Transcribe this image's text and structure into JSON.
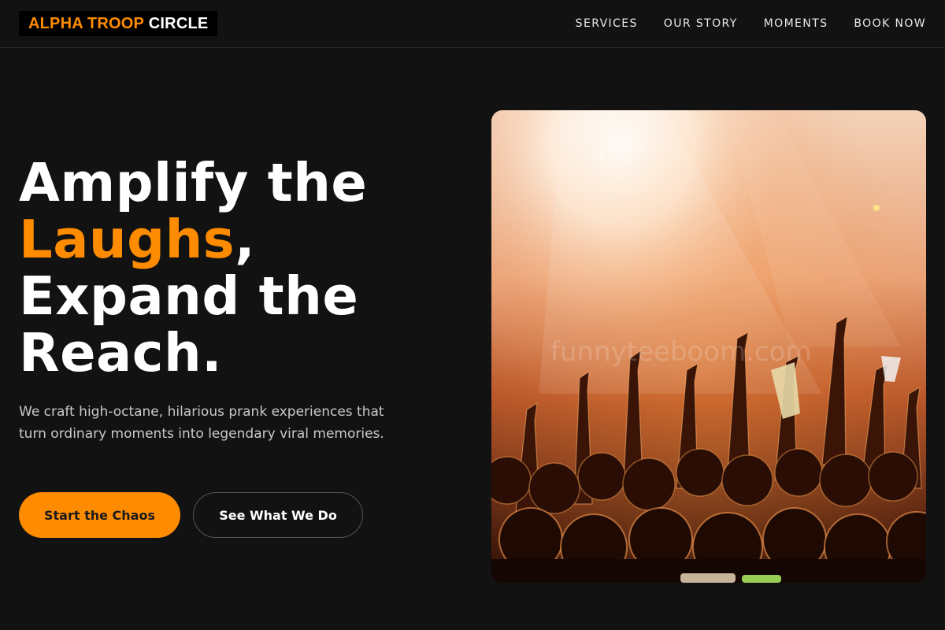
{
  "brand": {
    "part1": "ALPHA TROOP",
    "part2": "CIRCLE",
    "accent_color": "#ff8c00"
  },
  "nav": {
    "items": [
      {
        "label": "SERVICES"
      },
      {
        "label": "OUR STORY"
      },
      {
        "label": "MOMENTS"
      },
      {
        "label": "BOOK NOW"
      }
    ]
  },
  "hero": {
    "title_line1": "Amplify the",
    "title_accent": "Laughs",
    "title_comma": ",",
    "title_line3": "Expand the",
    "title_line4": "Reach.",
    "subtitle": "We craft high-octane, hilarious prank experiences that turn ordinary moments into legendary viral memories.",
    "primary_cta": "Start the Chaos",
    "secondary_cta": "See What We Do",
    "image_subject": "concert crowd with raised hands under stage lights",
    "image_watermark": "funnyteeboom.com"
  },
  "colors": {
    "background": "#121212",
    "accent": "#ff8c00",
    "text": "#ffffff",
    "muted_text": "#c9c9c9"
  }
}
